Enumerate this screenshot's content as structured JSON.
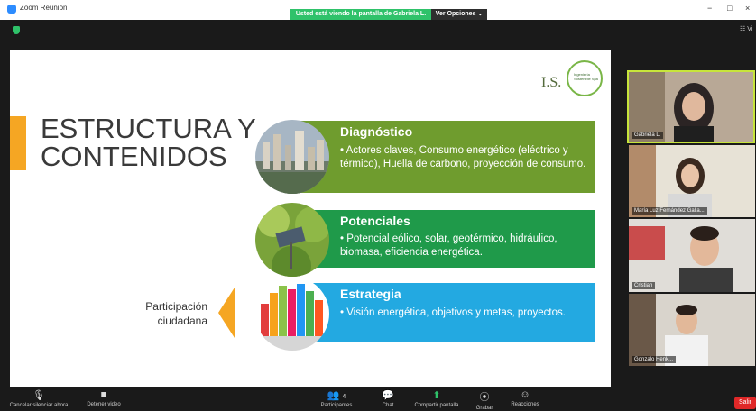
{
  "window": {
    "title": "Zoom Reunión",
    "share_banner": "Usted está viendo la pantalla de Gabriela L.",
    "view_options": "Ver Opciones ⌄",
    "view_button": "☷ Vi",
    "controls": [
      "−",
      "□",
      "×"
    ]
  },
  "slide": {
    "title_line1": "ESTRUCTURA Y",
    "title_line2": "CONTENIDOS",
    "logo_text": "I.S.",
    "logo_sub": "Ingeniería Sostenible Spa",
    "rows": [
      {
        "heading": "Diagnóstico",
        "bullet": "• Actores claves, Consumo energético (eléctrico y térmico), Huella de carbono, proyección de consumo.",
        "color": "#6f9c2e"
      },
      {
        "heading": "Potenciales",
        "bullet": "• Potencial eólico, solar, geotérmico, hidráulico, biomasa, eficiencia energética.",
        "color": "#1f9a4a"
      },
      {
        "heading": "Estrategia",
        "bullet": "• Visión energética, objetivos y metas, proyectos.",
        "color": "#23a9e1"
      }
    ],
    "side_label_line1": "Participación",
    "side_label_line2": "ciudadana"
  },
  "participants": [
    {
      "name": "Gabriela L."
    },
    {
      "name": "María Luz Fernández Galla..."
    },
    {
      "name": "Cristian"
    },
    {
      "name": "Gonzalo Henk..."
    }
  ],
  "toolbar": {
    "audio": "Cancelar silenciar ahora",
    "video": "Detener video",
    "participants": "Participantes",
    "participants_count": "4",
    "chat": "Chat",
    "share": "Compartir pantalla",
    "record": "Grabar",
    "reactions": "Reacciones",
    "leave": "Salir"
  },
  "colors": {
    "accent": "#f5a623",
    "share_green": "#2fc26a",
    "leave_red": "#e02828"
  },
  "icons": [
    "mic-muted-icon",
    "video-icon",
    "participants-icon",
    "chat-icon",
    "share-screen-icon",
    "record-icon",
    "reactions-icon",
    "shield-icon"
  ]
}
